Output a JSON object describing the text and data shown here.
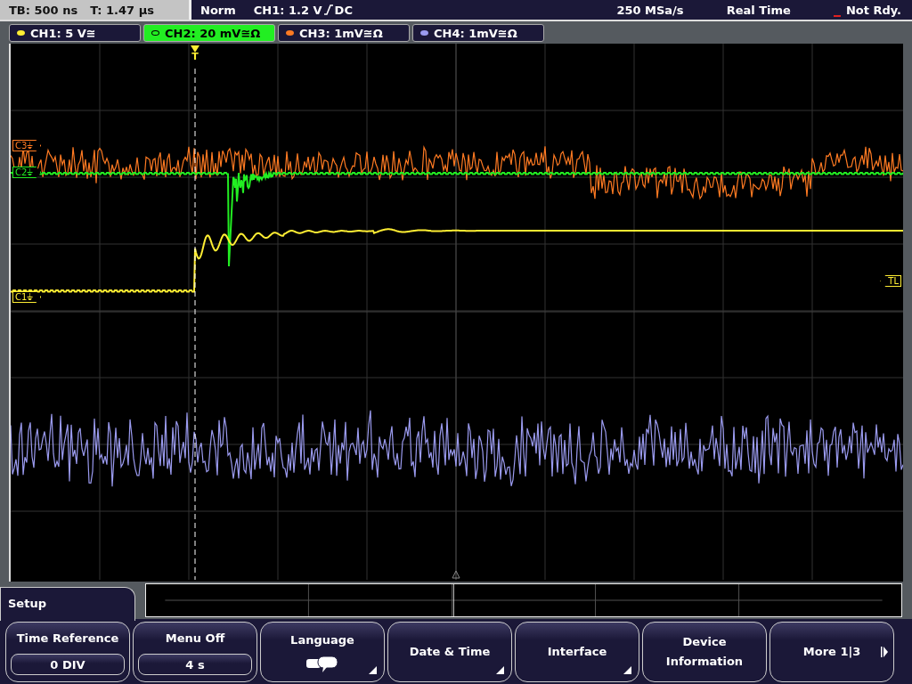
{
  "status_bar": {
    "timebase": "TB: 500 ns",
    "trigger_time": "T: 1.47 µs",
    "trigger_mode": "Norm",
    "trigger_source": "CH1: 1.2 V",
    "trigger_coupling": "DC",
    "sample_rate": "250 MSa/s",
    "acquisition": "Real Time",
    "state": "Not Rdy."
  },
  "channels": [
    {
      "label": "CH1: 5 V≅",
      "color": "#ffee33",
      "selected": false
    },
    {
      "label": "CH2: 20 mV≅Ω",
      "color": "#22ee22",
      "selected": true
    },
    {
      "label": "CH3: 1mV≅Ω",
      "color": "#ff7a22",
      "selected": false
    },
    {
      "label": "CH4: 1mV≅Ω",
      "color": "#9b9bf0",
      "selected": false
    }
  ],
  "display": {
    "trigger_label": "T",
    "markers": [
      {
        "label": "C3⏚",
        "color": "#ff7a22",
        "kind": "left"
      },
      {
        "label": "C2⏚",
        "color": "#22ee22",
        "kind": "left"
      },
      {
        "label": "C1⏚",
        "color": "#ffee33",
        "kind": "left"
      },
      {
        "label": "TL",
        "color": "#ffee33",
        "kind": "right"
      }
    ]
  },
  "menu": {
    "title": "Setup",
    "softkeys": [
      {
        "kind": "value",
        "label": "Time Reference",
        "value": "0 DIV"
      },
      {
        "kind": "value",
        "label": "Menu Off",
        "value": "4 s"
      },
      {
        "kind": "icon",
        "label": "Language",
        "submenu": true
      },
      {
        "kind": "plain",
        "label": "Date & Time",
        "submenu": true
      },
      {
        "kind": "plain",
        "label": "Interface",
        "submenu": true
      },
      {
        "kind": "plain",
        "label": "Device Information",
        "submenu": false
      },
      {
        "kind": "next",
        "label": "More 1|3",
        "submenu": false
      }
    ]
  }
}
